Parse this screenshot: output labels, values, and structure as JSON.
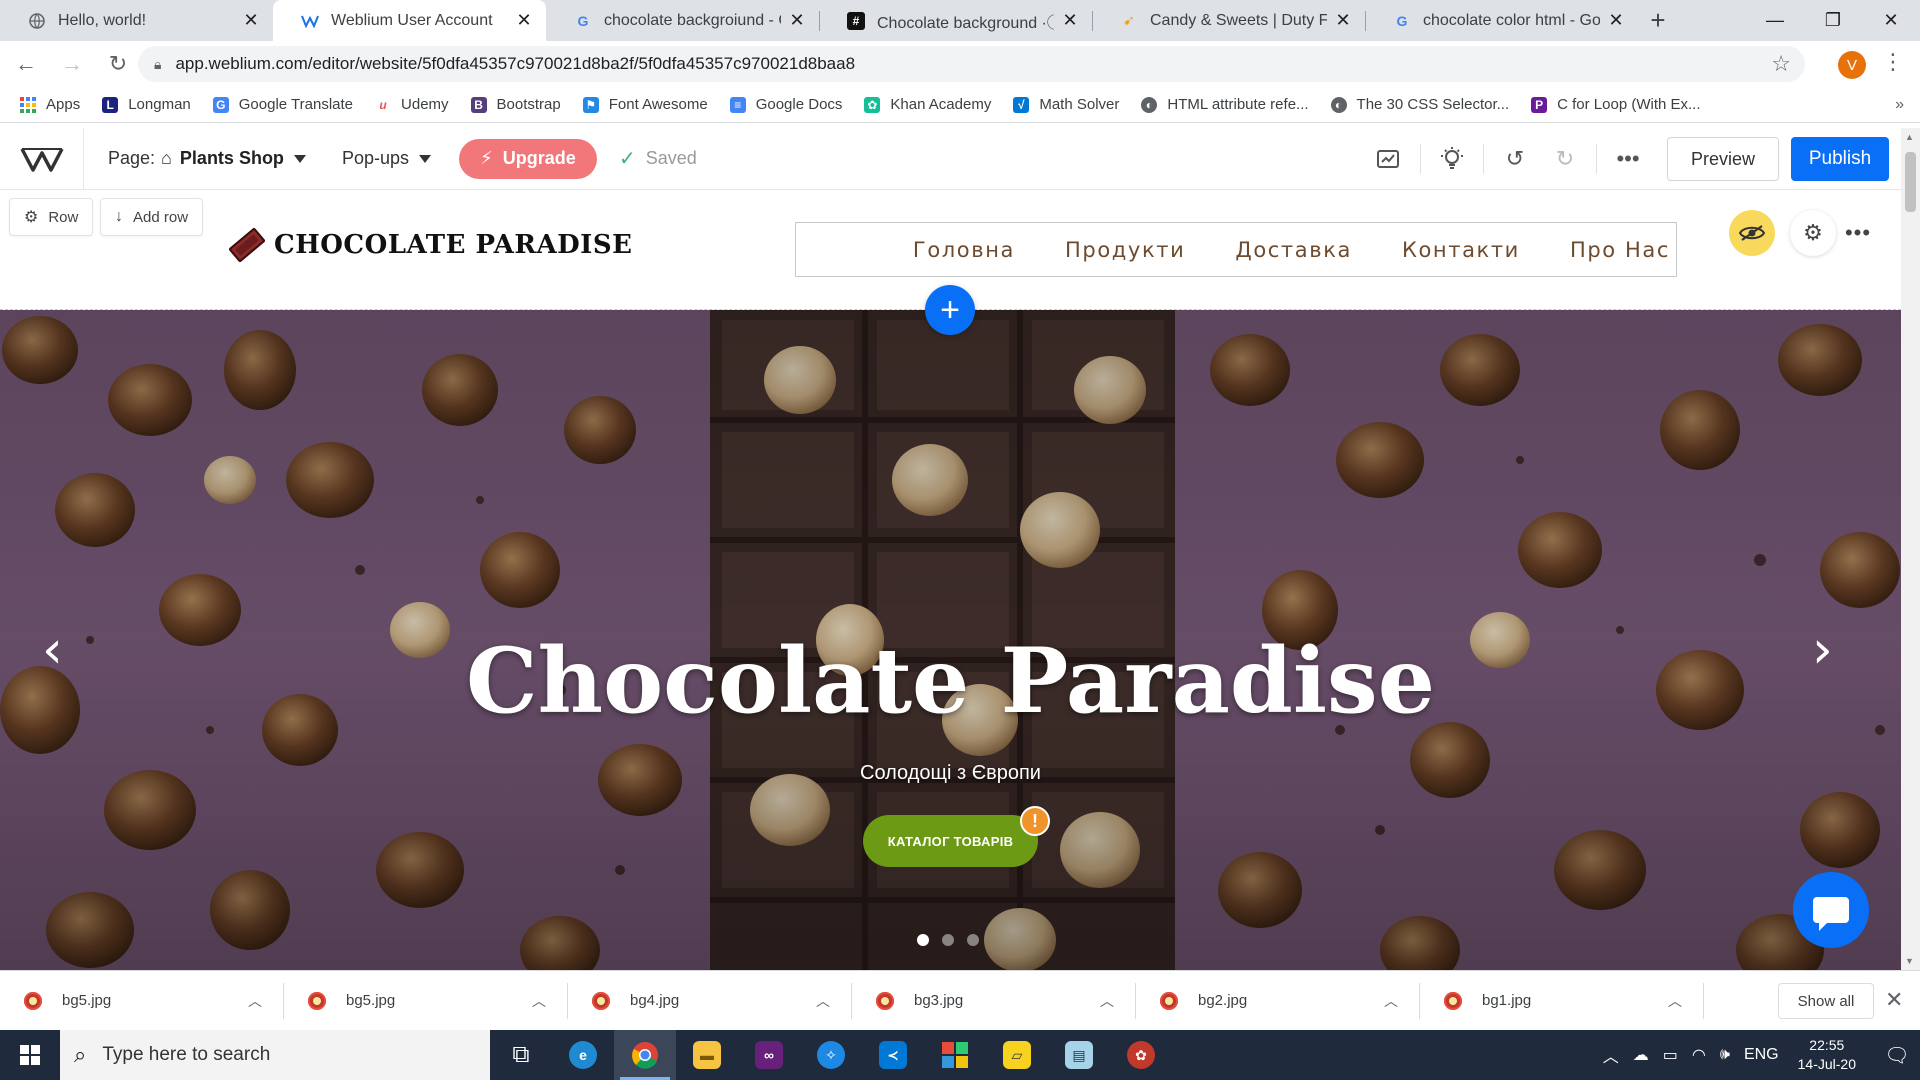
{
  "browser": {
    "tabs": [
      {
        "title": "Hello, world!",
        "icon": "globe-icon",
        "active": false
      },
      {
        "title": "Weblium User Account",
        "icon": "weblium-icon",
        "active": true
      },
      {
        "title": "chocolate backgroiund - Goo",
        "icon": "google-icon",
        "active": false
      },
      {
        "title": "Chocolate background ·ⓘ Do",
        "icon": "hashtag-icon",
        "active": false
      },
      {
        "title": "Candy & Sweets | Duty Free U",
        "icon": "candy-icon",
        "active": false
      },
      {
        "title": "chocolate color html - Googl",
        "icon": "google-icon",
        "active": false
      }
    ],
    "url": "app.weblium.com/editor/website/5f0dfa45357c970021d8ba2f/5f0dfa45357c970021d8baa8",
    "profile_initial": "V",
    "bookmarks": [
      {
        "label": "Apps",
        "icon": "apps-grid-icon",
        "color": "#4285f4"
      },
      {
        "label": "Longman",
        "icon": "longman-icon",
        "color": "#1a237e"
      },
      {
        "label": "Google Translate",
        "icon": "translate-icon",
        "color": "#4285f4"
      },
      {
        "label": "Udemy",
        "icon": "udemy-icon",
        "color": "#ec5252"
      },
      {
        "label": "Bootstrap",
        "icon": "bootstrap-icon",
        "color": "#563d7c"
      },
      {
        "label": "Font Awesome",
        "icon": "font-awesome-icon",
        "color": "#228ae6"
      },
      {
        "label": "Google Docs",
        "icon": "docs-icon",
        "color": "#4285f4"
      },
      {
        "label": "Khan Academy",
        "icon": "khan-icon",
        "color": "#14bf96"
      },
      {
        "label": "Math Solver",
        "icon": "math-solver-icon",
        "color": "#0078d4"
      },
      {
        "label": "HTML attribute refe...",
        "icon": "globe-icon",
        "color": "#5f6368"
      },
      {
        "label": "The 30 CSS Selector...",
        "icon": "globe-icon",
        "color": "#5f6368"
      },
      {
        "label": "C for Loop (With Ex...",
        "icon": "programiz-icon",
        "color": "#6a1b9a"
      }
    ]
  },
  "editor": {
    "page_label": "Page:",
    "page_name": "Plants Shop",
    "popups_label": "Pop-ups",
    "upgrade_label": "Upgrade",
    "saved_label": "Saved",
    "preview_label": "Preview",
    "publish_label": "Publish",
    "row_label": "Row",
    "add_row_label": "Add row"
  },
  "site": {
    "brand": "CHOCOLATE PARADISE",
    "nav": [
      "Головна",
      "Продукти",
      "Доставка",
      "Контакти",
      "Про Нас"
    ],
    "hero_title": "Chocolate Paradise",
    "hero_subtitle": "Солодощі з Європи",
    "cta_label": "КАТАЛОГ ТОВАРІВ",
    "warning_mark": "!",
    "slide_count": 3,
    "active_slide": 1
  },
  "downloads": {
    "files": [
      "bg5.jpg",
      "bg5.jpg",
      "bg4.jpg",
      "bg3.jpg",
      "bg2.jpg",
      "bg1.jpg"
    ],
    "show_all_label": "Show all"
  },
  "taskbar": {
    "search_placeholder": "Type here to search",
    "language": "ENG",
    "time": "22:55",
    "date": "14-Jul-20"
  },
  "colors": {
    "accent_blue": "#0a6ff7",
    "upgrade": "#f2777a",
    "cta_green": "#6d9a15",
    "hero_purple": "#7a5a7a"
  }
}
